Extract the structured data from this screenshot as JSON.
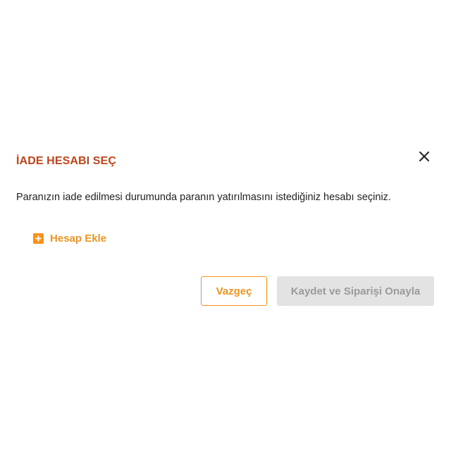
{
  "dialog": {
    "title": "İADE HESABI SEÇ",
    "close_icon": "close-icon",
    "description": "Paranızın iade edilmesi durumunda paranın yatırılmasını istediğiniz hesabı seçiniz.",
    "add_account": {
      "icon": "plus-square-icon",
      "label": "Hesap Ekle"
    },
    "buttons": {
      "cancel_label": "Vazgeç",
      "confirm_label": "Kaydet ve Siparişi Onayla"
    },
    "colors": {
      "title": "#c0441a",
      "accent": "#f5921e",
      "disabled_bg": "#e3e3e3",
      "disabled_text": "#9a9a9a"
    }
  }
}
